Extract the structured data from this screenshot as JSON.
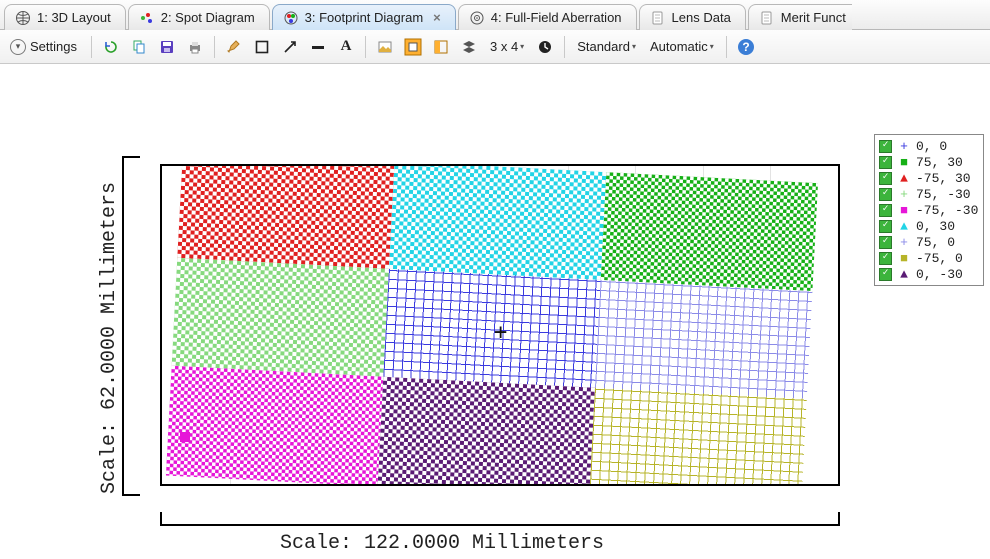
{
  "tabs": [
    {
      "label": "1: 3D Layout"
    },
    {
      "label": "2: Spot Diagram"
    },
    {
      "label": "3: Footprint Diagram",
      "active": true
    },
    {
      "label": "4: Full-Field Aberration"
    },
    {
      "label": "Lens Data"
    },
    {
      "label": "Merit Funct"
    }
  ],
  "toolbar": {
    "settings": "Settings",
    "grid": "3 x 4",
    "standard": "Standard",
    "automatic": "Automatic"
  },
  "axes": {
    "ylabel": "Scale: 62.0000 Millimeters",
    "xlabel": "Scale: 122.0000 Millimeters"
  },
  "legend": [
    {
      "color": "#3a3adf",
      "marker": "+",
      "label": "0, 0"
    },
    {
      "color": "#16b016",
      "marker": "■",
      "label": "75, 30"
    },
    {
      "color": "#e02020",
      "marker": "▲",
      "label": "-75, 30"
    },
    {
      "color": "#86d97e",
      "marker": "+",
      "label": "75, -30"
    },
    {
      "color": "#e616d8",
      "marker": "■",
      "label": "-75, -30"
    },
    {
      "color": "#22d4e6",
      "marker": "▲",
      "label": "0, 30"
    },
    {
      "color": "#8b8be8",
      "marker": "+",
      "label": "75, 0"
    },
    {
      "color": "#b7b428",
      "marker": "■",
      "label": "-75, 0"
    },
    {
      "color": "#5a1b74",
      "marker": "▲",
      "label": "0, -30"
    }
  ],
  "chart_data": {
    "type": "scatter",
    "title": "Footprint Diagram",
    "xlabel": "Scale: 122.0000 Millimeters",
    "ylabel": "Scale: 62.0000 Millimeters",
    "xlim": [
      -61,
      61
    ],
    "ylim": [
      -31,
      31
    ],
    "series": [
      {
        "name": "0, 0",
        "field": [
          0,
          0
        ],
        "color": "#3a3adf",
        "marker": "+",
        "approx_center": [
          0,
          0
        ]
      },
      {
        "name": "75, 30",
        "field": [
          75,
          30
        ],
        "color": "#16b016",
        "marker": "square",
        "approx_center": [
          40,
          16
        ]
      },
      {
        "name": "-75, 30",
        "field": [
          -75,
          30
        ],
        "color": "#e02020",
        "marker": "triangle",
        "approx_center": [
          -40,
          16
        ]
      },
      {
        "name": "75, -30",
        "field": [
          75,
          -30
        ],
        "color": "#86d97e",
        "marker": "+",
        "approx_center": [
          -40,
          0
        ]
      },
      {
        "name": "-75, -30",
        "field": [
          -75,
          -30
        ],
        "color": "#e616d8",
        "marker": "square",
        "approx_center": [
          -40,
          -16
        ]
      },
      {
        "name": "0, 30",
        "field": [
          0,
          30
        ],
        "color": "#22d4e6",
        "marker": "triangle",
        "approx_center": [
          0,
          16
        ]
      },
      {
        "name": "75, 0",
        "field": [
          75,
          0
        ],
        "color": "#8b8be8",
        "marker": "+",
        "approx_center": [
          40,
          0
        ]
      },
      {
        "name": "-75, 0",
        "field": [
          -75,
          0
        ],
        "color": "#b7b428",
        "marker": "square",
        "approx_center": [
          40,
          -16
        ]
      },
      {
        "name": "0, -30",
        "field": [
          0,
          -30
        ],
        "color": "#5a1b74",
        "marker": "triangle",
        "approx_center": [
          0,
          -16
        ]
      }
    ]
  }
}
